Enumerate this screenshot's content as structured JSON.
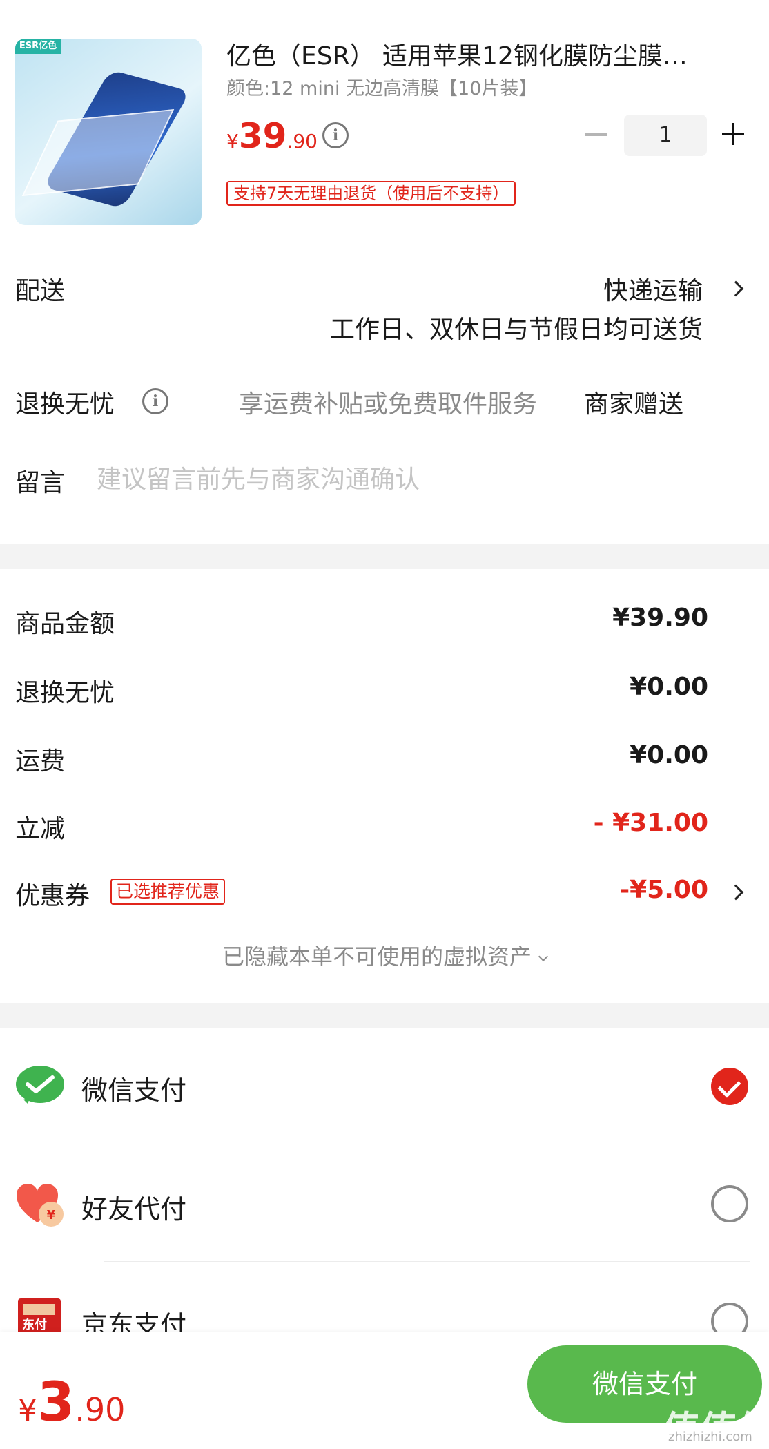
{
  "product": {
    "brand_logo_text": "ESR亿色",
    "title": "亿色（ESR） 适用苹果12钢化膜防尘膜…",
    "spec": "颜色:12 mini 无边高清膜【10片装】",
    "price_currency": "¥",
    "price_int": "39",
    "price_dec": ".90",
    "quantity": "1",
    "return_policy": "支持7天无理由退货（使用后不支持）"
  },
  "delivery": {
    "label": "配送",
    "value": "快递运输",
    "note": "工作日、双休日与节假日均可送货"
  },
  "service": {
    "label": "退换无忧",
    "description": "享运费补贴或免费取件服务",
    "value": "商家赠送"
  },
  "message": {
    "label": "留言",
    "placeholder": "建议留言前先与商家沟通确认"
  },
  "summary": {
    "goods_label": "商品金额",
    "goods_value": "¥39.90",
    "service_label": "退换无忧",
    "service_value": "¥0.00",
    "shipping_label": "运费",
    "shipping_value": "¥0.00",
    "discount_label": "立减",
    "discount_value": "- ¥31.00",
    "coupon_label": "优惠券",
    "coupon_tag": "已选推荐优惠",
    "coupon_value": "-¥5.00",
    "hidden_assets": "已隐藏本单不可使用的虚拟资产"
  },
  "payment": {
    "methods": [
      {
        "label": "微信支付",
        "selected": true
      },
      {
        "label": "好友代付",
        "selected": false
      },
      {
        "label": "京东支付",
        "selected": false
      }
    ],
    "jd_icon_text": "东付"
  },
  "footer": {
    "total_currency": "¥",
    "total_int": "3",
    "total_dec": ".90",
    "pay_button": "微信支付",
    "watermark": "值值值",
    "watermark_sub": "zhizhizhi.com"
  },
  "colors": {
    "accent_red": "#e1251b",
    "pay_green": "#59b94d",
    "muted_gray": "#8a8a8a"
  }
}
